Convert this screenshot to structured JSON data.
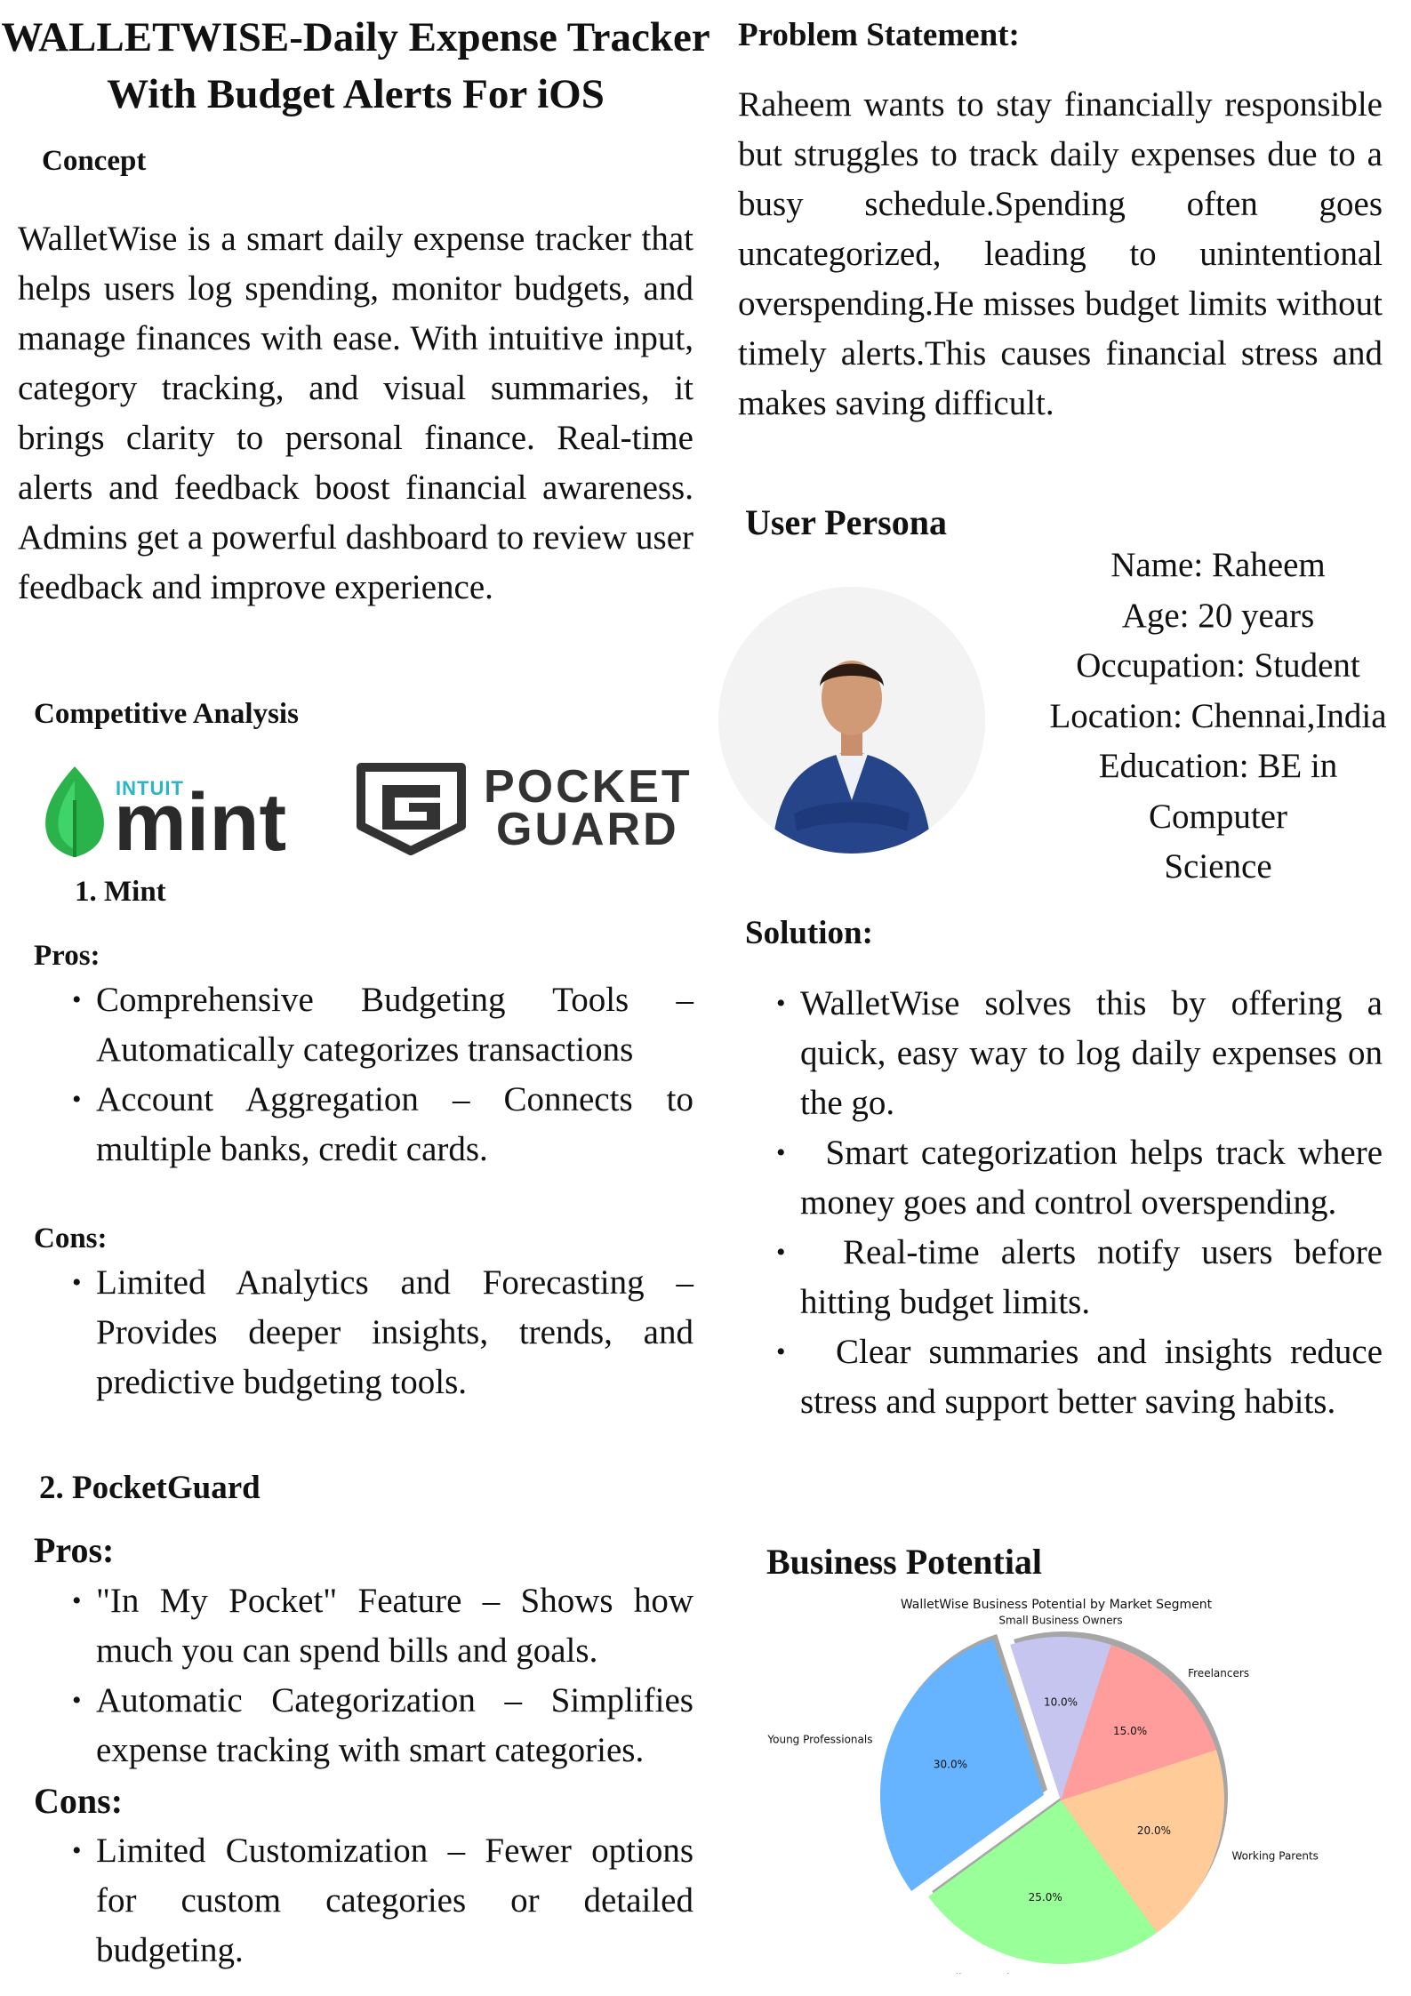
{
  "title": {
    "line1": "WALLETWISE-Daily Expense Tracker",
    "line2": "With Budget Alerts For iOS"
  },
  "concept": {
    "heading": "Concept",
    "text": "WalletWise is a smart daily expense tracker that helps users log spending, monitor budgets, and manage finances with ease. With intuitive input, category tracking, and visual summaries, it brings clarity to personal finance. Real-time alerts and feedback boost financial awareness. Admins get a powerful dashboard to review user feedback and improve experience."
  },
  "competitive": {
    "heading": "Competitive Analysis",
    "logos": {
      "mint": {
        "small": "INTUIT",
        "big": "mint",
        "color": "#2a2a2a",
        "leaf_color": "#2ab34b",
        "icon": "mint-leaf-icon"
      },
      "pocketguard": {
        "line1": "POCKET",
        "line2": "GUARD",
        "color": "#333333",
        "icon": "pocketguard-shield-icon"
      }
    },
    "mint": {
      "heading": "1. Mint",
      "pros_label": "Pros:",
      "pros": [
        "Comprehensive Budgeting Tools – Automatically categorizes transactions",
        "Account Aggregation – Connects to multiple banks, credit cards."
      ],
      "cons_label": "Cons:",
      "cons": [
        "Limited Analytics and Forecasting – Provides deeper insights, trends, and predictive budgeting tools."
      ]
    },
    "pocketguard": {
      "heading": "2. PocketGuard",
      "pros_label": "Pros:",
      "pros": [
        "\"In My Pocket\" Feature – Shows how much you can spend bills and goals.",
        "Automatic Categorization – Simplifies expense tracking with smart categories."
      ],
      "cons_label": "Cons:",
      "cons": [
        "Limited Customization – Fewer options for custom categories or detailed budgeting."
      ]
    }
  },
  "problem": {
    "heading": "Problem Statement:",
    "text": "Raheem wants to stay financially responsible but struggles to track daily expenses due to a busy schedule.Spending often goes uncategorized, leading to unintentional overspending.He misses budget limits without timely alerts.This causes financial stress and makes saving difficult."
  },
  "persona": {
    "heading": "User Persona",
    "photo_icon": "person-photo-icon",
    "lines": [
      "Name: Raheem",
      "Age: 20 years",
      "Occupation: Student",
      "Location: Chennai,India",
      "Education: BE in",
      "Computer",
      "Science"
    ]
  },
  "solution": {
    "heading": "Solution:",
    "items": [
      "WalletWise solves this by offering a quick, easy way to log daily expenses on the go.",
      "Smart categorization helps track where money goes and control overspending.",
      "Real-time alerts notify users before hitting budget limits.",
      "Clear summaries and insights reduce stress and support better saving habits."
    ]
  },
  "business": {
    "heading": "Business Potential"
  },
  "chart_data": {
    "type": "pie",
    "title": "WalletWise Business Potential by Market Segment",
    "slices": [
      {
        "label": "Small Business Owners",
        "value": 10.0,
        "color": "#c5c5f0",
        "exploded": false
      },
      {
        "label": "Freelancers",
        "value": 15.0,
        "color": "#ff9c9c",
        "exploded": false
      },
      {
        "label": "Working Parents",
        "value": 20.0,
        "color": "#ffcc99",
        "exploded": false
      },
      {
        "label": "College Students",
        "value": 25.0,
        "color": "#99ff99",
        "exploded": false
      },
      {
        "label": "Young Professionals",
        "value": 30.0,
        "color": "#66b3ff",
        "exploded": true
      }
    ],
    "start_angle_deg": 108,
    "direction": "clockwise",
    "shadow": true,
    "pct_format": "1 decimal"
  }
}
